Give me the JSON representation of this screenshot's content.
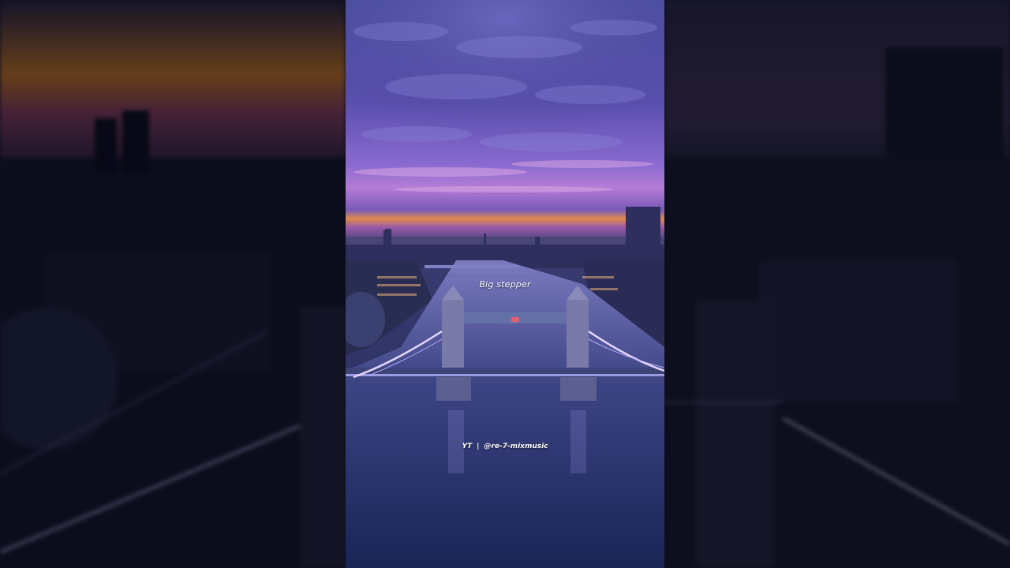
{
  "video": {
    "lyric_caption": "Big stepper",
    "credit": {
      "platform": "YT",
      "separator": "|",
      "handle": "@re-7-mixmusic"
    }
  },
  "colors": {
    "sky_top": "#4a4a9a",
    "sky_mid": "#6a5cbf",
    "horizon_pink": "#c47ac8",
    "horizon_orange": "#e08a4a",
    "river": "#2a3470",
    "bridge_lights": "#e6d8ff"
  }
}
